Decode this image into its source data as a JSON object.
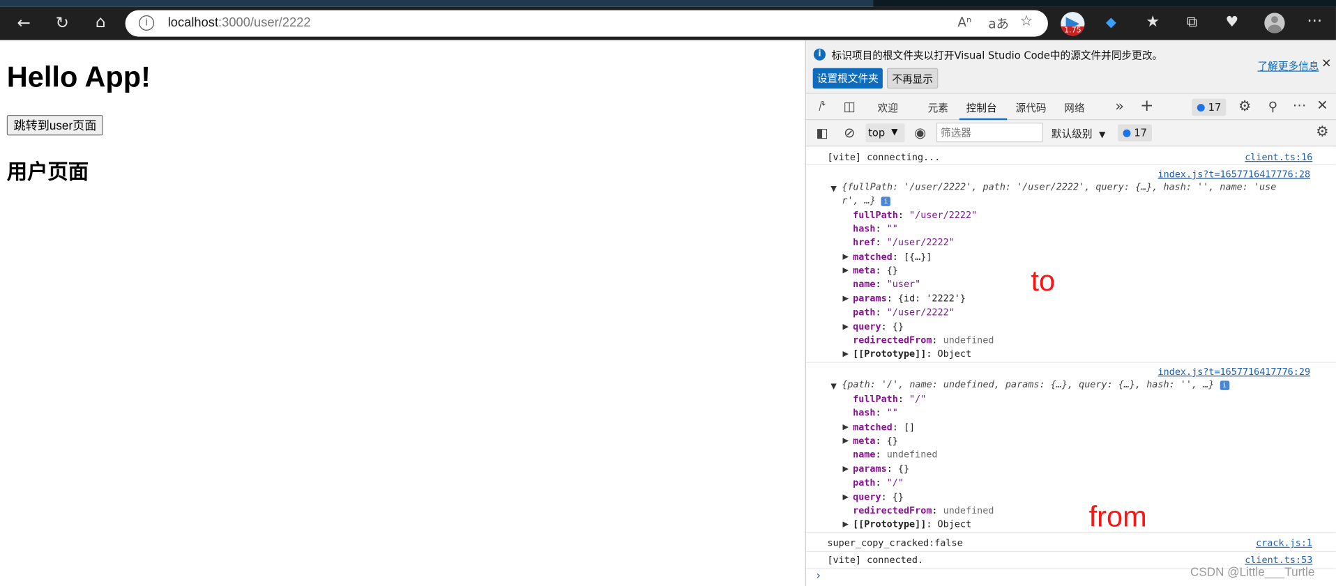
{
  "browser": {
    "address": {
      "host": "localhost",
      "path": ":3000/user/2222"
    },
    "ext_badge": "1.75",
    "read_aloud_icon": "read-aloud-icon",
    "translate_icon": "translate-icon"
  },
  "page": {
    "title": "Hello App!",
    "button_label": "跳转到user页面",
    "subtitle": "用户页面"
  },
  "devtools": {
    "infobar": {
      "message": "标识项目的根文件夹以打开Visual Studio Code中的源文件并同步更改。",
      "set_root_label": "设置根文件夹",
      "dont_show_label": "不再显示",
      "learn_more_label": "了解更多信息"
    },
    "tabs": [
      "欢迎",
      "元素",
      "控制台",
      "源代码",
      "网络"
    ],
    "issues_count": "17",
    "console_toolbar": {
      "context": "top",
      "filter_placeholder": "筛选器",
      "level": "默认级别",
      "issues_count": "17"
    }
  },
  "console": {
    "log1": {
      "text": "[vite] connecting...",
      "source": "client.ts:16"
    },
    "log2": {
      "source": "index.js?t=1657716417776:28",
      "summary_line1": "{fullPath: '/user/2222', path: '/user/2222', query: {…}, hash: '', name: 'use",
      "summary_line2": "r', …}",
      "props": [
        {
          "key": "fullPath",
          "value": "\"/user/2222\""
        },
        {
          "key": "hash",
          "value": "\"\""
        },
        {
          "key": "href",
          "value": "\"/user/2222\""
        },
        {
          "key": "matched",
          "value": "[{…}]"
        },
        {
          "key": "meta",
          "value": "{}"
        },
        {
          "key": "name",
          "value": "\"user\""
        },
        {
          "key": "params",
          "value": "{id: '2222'}"
        },
        {
          "key": "path",
          "value": "\"/user/2222\""
        },
        {
          "key": "query",
          "value": "{}"
        },
        {
          "key": "redirectedFrom",
          "value": "undefined"
        },
        {
          "key": "[[Prototype]]",
          "value": "Object"
        }
      ]
    },
    "log3": {
      "source": "index.js?t=1657716417776:29",
      "summary": "{path: '/', name: undefined, params: {…}, query: {…}, hash: '', …}",
      "props": [
        {
          "key": "fullPath",
          "value": "\"/\""
        },
        {
          "key": "hash",
          "value": "\"\""
        },
        {
          "key": "matched",
          "value": "[]"
        },
        {
          "key": "meta",
          "value": "{}"
        },
        {
          "key": "name",
          "value": "undefined"
        },
        {
          "key": "params",
          "value": "{}"
        },
        {
          "key": "path",
          "value": "\"/\""
        },
        {
          "key": "query",
          "value": "{}"
        },
        {
          "key": "redirectedFrom",
          "value": "undefined"
        },
        {
          "key": "[[Prototype]]",
          "value": "Object"
        }
      ]
    },
    "log4": {
      "text": "super_copy_cracked:false",
      "source": "crack.js:1"
    },
    "log5": {
      "text": "[vite] connected.",
      "source": "client.ts:53"
    }
  },
  "annotations": {
    "to": "to",
    "from": "from"
  },
  "watermark": "CSDN @Little___Turtle"
}
